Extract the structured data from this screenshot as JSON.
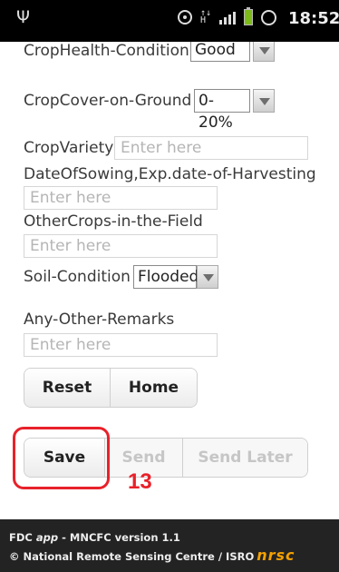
{
  "status_bar": {
    "time": "18:52",
    "icons": [
      "usb-icon",
      "gps-icon",
      "data-updown-icon",
      "signal-icon",
      "battery-icon",
      "alarm-icon"
    ]
  },
  "form": {
    "crop_health": {
      "label": "CropHealth-Condition",
      "value": "Good"
    },
    "crop_cover": {
      "label": "CropCover-on-Ground",
      "value": "0-20%"
    },
    "crop_variety": {
      "label": "CropVariety",
      "placeholder": "Enter here"
    },
    "date_of_sowing": {
      "label": "DateOfSowing,Exp.date-of-Harvesting",
      "placeholder": "Enter here"
    },
    "other_crops": {
      "label": "OtherCrops-in-the-Field",
      "placeholder": "Enter here"
    },
    "soil_condition": {
      "label": "Soil-Condition",
      "value": "Flooded"
    },
    "remarks": {
      "label": "Any-Other-Remarks",
      "placeholder": "Enter here"
    }
  },
  "buttons": {
    "reset": "Reset",
    "home": "Home",
    "save": "Save",
    "send": "Send",
    "send_later": "Send Later"
  },
  "annotation": {
    "step": "13",
    "color": "#e8212a"
  },
  "footer": {
    "line1_prefix": "FDC ",
    "line1_app": "app",
    "line1_suffix": " - MNCFC version 1.1",
    "line2": "© National Remote Sensing Centre / ISRO",
    "logo": "nrsc",
    "logo_color": "#f4a100"
  }
}
